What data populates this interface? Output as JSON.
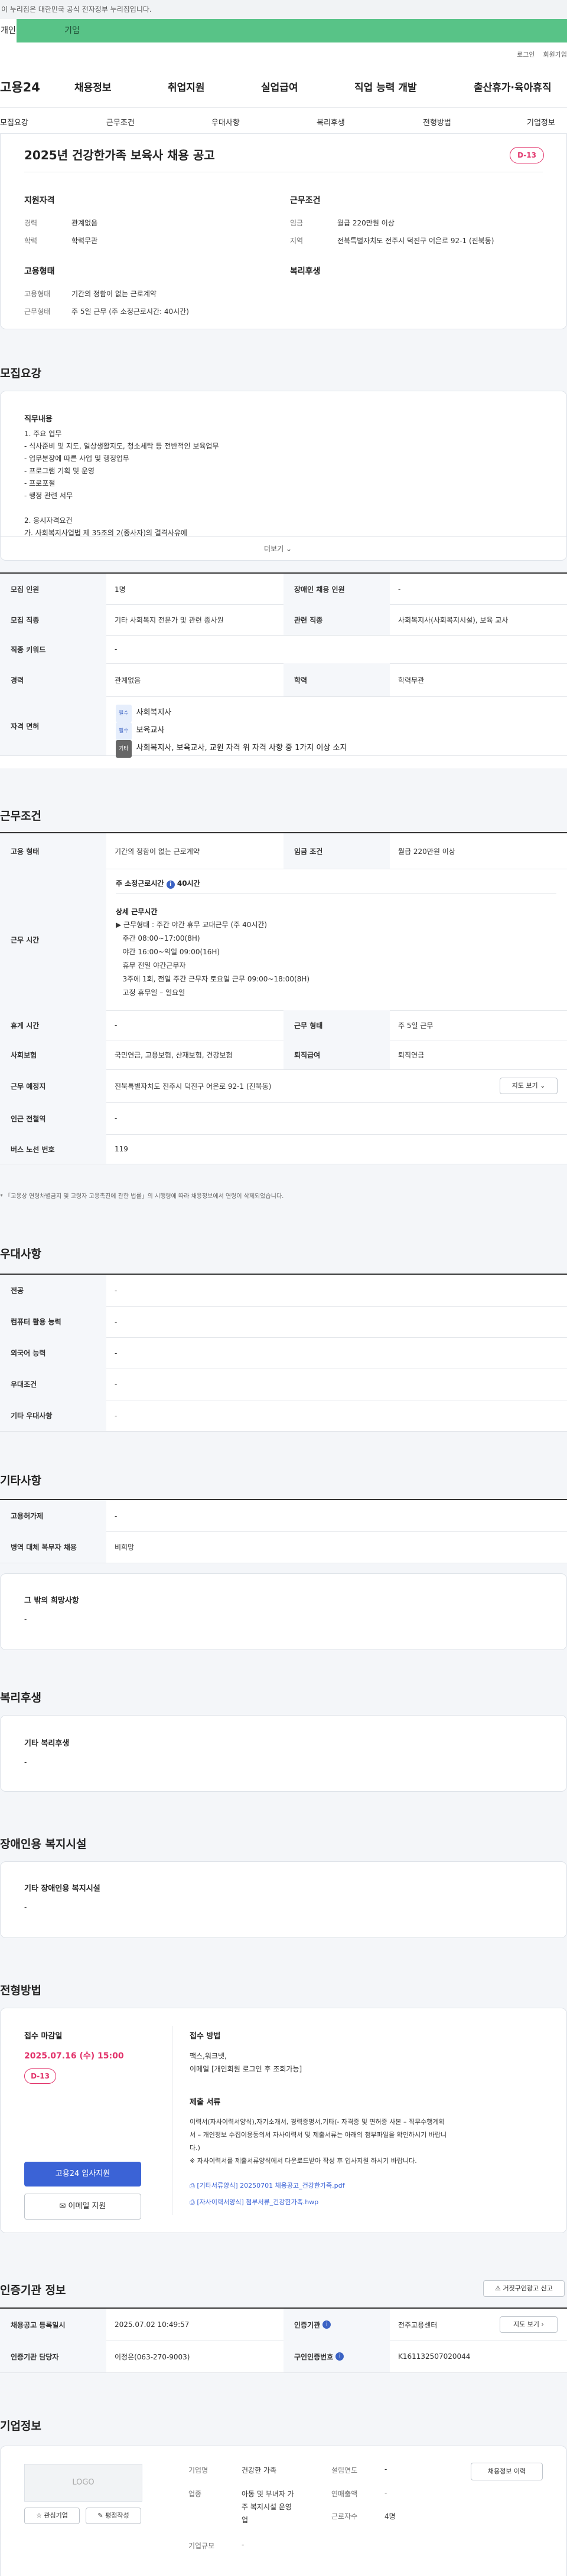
{
  "gov_banner": "이 누리집은 대한민국 공식 전자정부 누리집입니다.",
  "user_tabs": [
    "개인",
    "기업"
  ],
  "util_links": [
    "로그인",
    "회원가입"
  ],
  "logo": "고용24",
  "gnb": [
    "채용정보",
    "취업지원",
    "실업급여",
    "직업 능력 개발",
    "출산휴가·육아휴직"
  ],
  "subnav": [
    "모집요강",
    "근무조건",
    "우대사항",
    "복리후생",
    "전형방법",
    "기업정보"
  ],
  "job": {
    "title": "2025년 건강한가족 보육사 채용 공고",
    "dday": "D-13",
    "qual_title": "지원자격",
    "qual": [
      {
        "k": "경력",
        "v": "관계없음"
      },
      {
        "k": "학력",
        "v": "학력무관"
      }
    ],
    "cond_title": "근무조건",
    "cond": [
      {
        "k": "임금",
        "v": "월급 220만원 이상"
      },
      {
        "k": "지역",
        "v": "전북특별자치도 전주시 덕진구 어은로 92-1 (진북동)"
      }
    ],
    "emp_title": "고용형태",
    "emp": [
      {
        "k": "고용형태",
        "v": "기간의 정함이 없는 근로계약"
      },
      {
        "k": "근무형태",
        "v": "주 5일 근무 (주 소정근로시간: 40시간)"
      }
    ],
    "welfare_title": "복리후생"
  },
  "recruit": {
    "section": "모집요강",
    "duty_title": "직무내용",
    "duty_text": "1. 주요 업무\n- 식사준비 및 지도, 일상생활지도, 청소세탁 등 전반적인 보육업무\n- 업무분장에 따른 사업 및 행정업무\n- 프로그램 기획 및 운영\n- 프로포절\n- 행정 관련 서무\n\n2. 응시자격요건\n가. 사회복지사업법 제 35조의 2(종사자)의 결격사유에",
    "more": "더보기",
    "rows": {
      "count_k": "모집 인원",
      "count_v": "1명",
      "disabled_k": "장애인 채용 인원",
      "disabled_v": "-",
      "job_k": "모집 직종",
      "job_v": "기타 사회복지 전문가 및 관련 종사원",
      "rel_k": "관련 직종",
      "rel_v": "사회복지사(사회복지시설), 보육 교사",
      "kw_k": "직종 키워드",
      "kw_v": "-",
      "career_k": "경력",
      "career_v": "관계없음",
      "edu_k": "학력",
      "edu_v": "학력무관",
      "lic_k": "자격 면허",
      "lic": [
        {
          "tag": "필수",
          "text": "사회복지사"
        },
        {
          "tag": "필수",
          "text": "보육교사"
        },
        {
          "tag": "기타",
          "text": "사회복지사, 보육교사, 교원 자격 위 자격 사항 중 1가지 이상 소지"
        }
      ]
    }
  },
  "work": {
    "section": "근무조건",
    "type_k": "고용 형태",
    "type_v": "기간의 정함이 없는 근로계약",
    "wage_k": "임금 조건",
    "wage_v": "월급 220만원 이상",
    "hours_k": "근무 시간",
    "hours_head": "주 소정근로시간",
    "hours_head_val": "40시간",
    "hours_detail_title": "상세 근무시간",
    "hours_text": "▶ 근무형태 : 주간 야간 휴무 교대근무 (주 40시간)\n   주간 08:00~17:00(8H)\n   야간 16:00~익일 09:00(16H)\n   휴무 전일 야간근무자\n   3주에 1회, 전일 주간 근무자 토요일 근무 09:00~18:00(8H)\n   고정 휴무일 – 일요일",
    "rest_k": "휴게 시간",
    "rest_v": "-",
    "form_k": "근무 형태",
    "form_v": "주 5일 근무",
    "ins_k": "사회보험",
    "ins_v": "국민연금, 고용보험, 산재보험, 건강보험",
    "ret_k": "퇴직급여",
    "ret_v": "퇴직연금",
    "place_k": "근무 예정지",
    "place_v": "전북특별자치도 전주시 덕진구 어은로 92-1 (진북동)",
    "map_btn": "지도 보기",
    "station_k": "인근 전철역",
    "station_v": "-",
    "bus_k": "버스 노선 번호",
    "bus_v": "119",
    "note": "* 「고용상 연령차별금지 및 고령자 고용촉진에 관한 법률」의 시행령에 따라 채용정보에서 연령이 삭제되었습니다."
  },
  "pref": {
    "section": "우대사항",
    "rows": [
      {
        "k": "전공",
        "v": "-"
      },
      {
        "k": "컴퓨터 활용 능력",
        "v": "-"
      },
      {
        "k": "외국어 능력",
        "v": "-"
      },
      {
        "k": "우대조건",
        "v": "-"
      },
      {
        "k": "기타 우대사항",
        "v": "-"
      }
    ]
  },
  "etc": {
    "section": "기타사항",
    "rows": [
      {
        "k": "고용허가제",
        "v": "-"
      },
      {
        "k": "병역 대체 복무자 채용",
        "v": "비희망"
      }
    ],
    "wish_title": "그 밖의 희망사항",
    "wish_v": "-"
  },
  "welfare": {
    "section": "복리후생",
    "title": "기타 복리후생",
    "v": "-"
  },
  "disab": {
    "section": "장애인용 복지시설",
    "title": "기타 장애인용 복지시설",
    "v": "-"
  },
  "screen": {
    "section": "전형방법",
    "deadline_k": "접수 마감일",
    "deadline_v": "2025.07.16 (수) 15:00",
    "dday": "D-13",
    "apply_btn": "고용24 입사지원",
    "email_btn": "이메일 지원",
    "method_title": "접수 방법",
    "method_text": "팩스,워크넷,\n이메일 [개인회원 로그인 후 조회가능]",
    "docs_title": "제출 서류",
    "docs_text": "이력서(자사이력서양식),자기소개서, 경력증명서,기타(- 자격증 및 면허증 사본 – 직무수행계획\n서 – 개인정보 수집이용동의서 자사이력서 및 제출서류는 아래의 첨부파일을 확인하시기 바랍니\n다.)\n※ 자사이력서를 제출서류양식에서 다운로드받아 작성 후 입사지원 하시기 바랍니다.",
    "files": [
      "[기타서류양식] 20250701 채용공고_건강한가족.pdf",
      "[자사이력서양식] 첨부서류_건강한가족.hwp"
    ]
  },
  "agency": {
    "section": "인증기관 정보",
    "report_btn": "거짓구인광고 신고",
    "reg_k": "채용공고 등록일시",
    "reg_v": "2025.07.02 10:49:57",
    "org_k": "인증기관",
    "org_v": "전주고용센터",
    "map_btn": "지도 보기",
    "mgr_k": "인증기관 담당자",
    "mgr_v": "이정은(063-270-9003)",
    "no_k": "구인인증번호",
    "no_v": "K161132507020044"
  },
  "company": {
    "section": "기업정보",
    "logo": "LOGO",
    "fav_btn": "관심기업",
    "review_btn": "평점작성",
    "info_btn": "채용정보 이력",
    "name_k": "기업명",
    "name_v": "건강한 가족",
    "year_k": "설립연도",
    "year_v": "-",
    "biz_k": "업종",
    "biz_v": "아동 및 부녀자 가\n주 복지시설 운영\n업",
    "sales_k": "연매출액",
    "sales_v": "-",
    "emp_k": "근로자수",
    "emp_v": "4명",
    "size_k": "기업규모",
    "size_v": "-"
  }
}
